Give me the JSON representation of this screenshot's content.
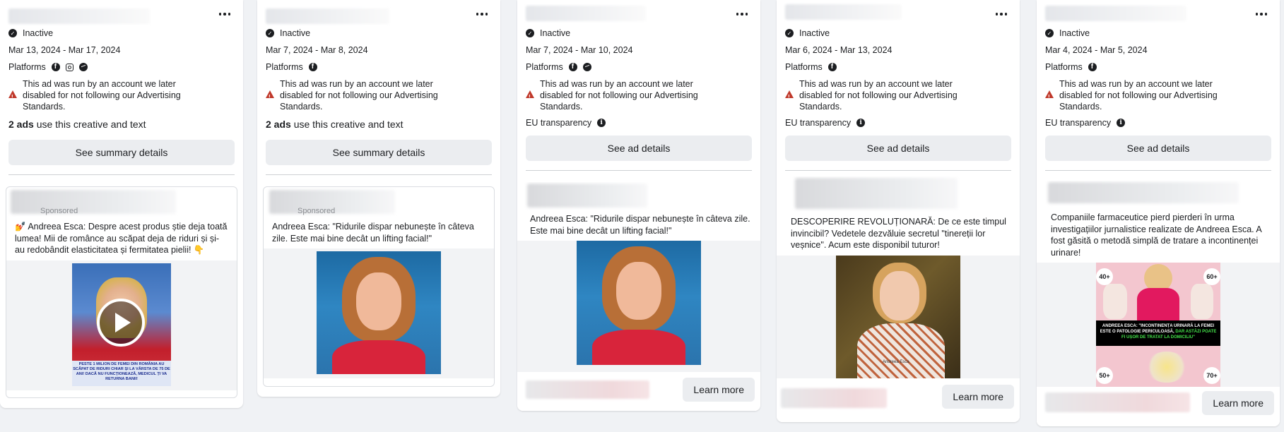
{
  "cards": [
    {
      "status": "Inactive",
      "dates": "Mar 13, 2024 - Mar 17, 2024",
      "platforms_label": "Platforms",
      "warning": "This ad was run by an account we later disabled for not following our Advertising Standards.",
      "ads_count_bold": "2 ads",
      "ads_count_rest": " use this creative and text",
      "button": "See summary details",
      "sponsored": "Sponsored",
      "ad_text": "💅 Andreea Esca: Despre acest produs știe deja toată lumea! Mii de românce au scăpat deja de riduri și și-au redobândit elasticitatea și fermitatea pielii! 👇",
      "video_caption": "PESTE 1 MILION DE FEMEI DIN ROMÂNIA AU SCĂPAT DE RIDURI CHIAR ȘI LA VÂRSTA DE 75 DE ANI! DACĂ NU FUNCȚIONEAZĂ, MEDICUL ȚI VA RETURNA BANII!"
    },
    {
      "status": "Inactive",
      "dates": "Mar 7, 2024 - Mar 8, 2024",
      "platforms_label": "Platforms",
      "warning": "This ad was run by an account we later disabled for not following our Advertising Standards.",
      "ads_count_bold": "2 ads",
      "ads_count_rest": " use this creative and text",
      "button": "See summary details",
      "sponsored": "Sponsored",
      "ad_text": "Andreea Esca: \"Ridurile dispar nebunește în câteva zile. Este mai bine decât un lifting facial!\""
    },
    {
      "status": "Inactive",
      "dates": "Mar 7, 2024 - Mar 10, 2024",
      "platforms_label": "Platforms",
      "warning": "This ad was run by an account we later disabled for not following our Advertising Standards.",
      "eu_label": "EU transparency",
      "button": "See ad details",
      "ad_text": "Andreea Esca: \"Ridurile dispar nebunește în câteva zile. Este mai bine decât un lifting facial!\"",
      "learn_more": "Learn more"
    },
    {
      "status": "Inactive",
      "dates": "Mar 6, 2024 - Mar 13, 2024",
      "platforms_label": "Platforms",
      "warning": "This ad was run by an account we later disabled for not following our Advertising Standards.",
      "eu_label": "EU transparency",
      "button": "See ad details",
      "ad_text": "DESCOPERIRE REVOLUȚIONARĂ: De ce este timpul invincibil? Vedetele dezvăluie secretul \"tinereții lor veșnice\". Acum este disponibil tuturor!",
      "photo_caption": "Andreea Esca",
      "learn_more": "Learn more"
    },
    {
      "status": "Inactive",
      "dates": "Mar 4, 2024 - Mar 5, 2024",
      "platforms_label": "Platforms",
      "warning": "This ad was run by an account we later disabled for not following our Advertising Standards.",
      "eu_label": "EU transparency",
      "button": "See ad details",
      "ad_text": "Companiile farmaceutice pierd pierderi în urma investigațiilor jurnalistice realizate de Andreea Esca. A fost găsită o metodă simplă de tratare a incontinenței urinare!",
      "ages": [
        "40+",
        "60+",
        "50+",
        "70+"
      ],
      "banner_white": "ANDREEA ESCA: ",
      "banner_yellow": "\"INCONTINENȚA URINARĂ LA FEMEI ESTE O PATOLOGIE PERICULOASĂ, ",
      "banner_green": "DAR ASTĂZI POATE FI UȘOR DE TRATAT LA DOMICILIU\"",
      "learn_more": "Learn more"
    }
  ]
}
